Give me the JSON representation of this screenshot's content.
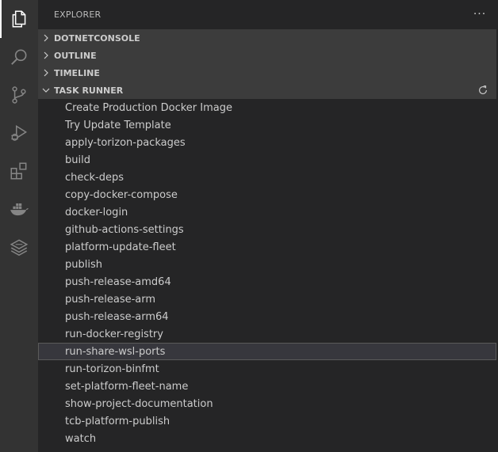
{
  "activity_bar": {
    "items": [
      {
        "name": "explorer-icon",
        "active": true
      },
      {
        "name": "search-icon",
        "active": false
      },
      {
        "name": "source-control-icon",
        "active": false
      },
      {
        "name": "run-debug-icon",
        "active": false
      },
      {
        "name": "extensions-icon",
        "active": false
      },
      {
        "name": "docker-icon",
        "active": false
      },
      {
        "name": "layers-icon",
        "active": false
      }
    ]
  },
  "sidebar": {
    "title": "EXPLORER",
    "more_label": "···",
    "sections": [
      {
        "label": "DOTNETCONSOLE",
        "expanded": false
      },
      {
        "label": "OUTLINE",
        "expanded": false
      },
      {
        "label": "TIMELINE",
        "expanded": false
      },
      {
        "label": "TASK RUNNER",
        "expanded": true
      }
    ],
    "tasks": [
      "Create Production Docker Image",
      "Try Update Template",
      "apply-torizon-packages",
      "build",
      "check-deps",
      "copy-docker-compose",
      "docker-login",
      "github-actions-settings",
      "platform-update-fleet",
      "publish",
      "push-release-amd64",
      "push-release-arm",
      "push-release-arm64",
      "run-docker-registry",
      "run-share-wsl-ports",
      "run-torizon-binfmt",
      "set-platform-fleet-name",
      "show-project-documentation",
      "tcb-platform-publish",
      "watch"
    ],
    "selected_task": "run-share-wsl-ports"
  },
  "colors": {
    "activity_bar": "#333333",
    "sidebar": "#252526",
    "section_header": "#3c3c3c",
    "selection": "#37373d",
    "text": "#cccccc"
  }
}
